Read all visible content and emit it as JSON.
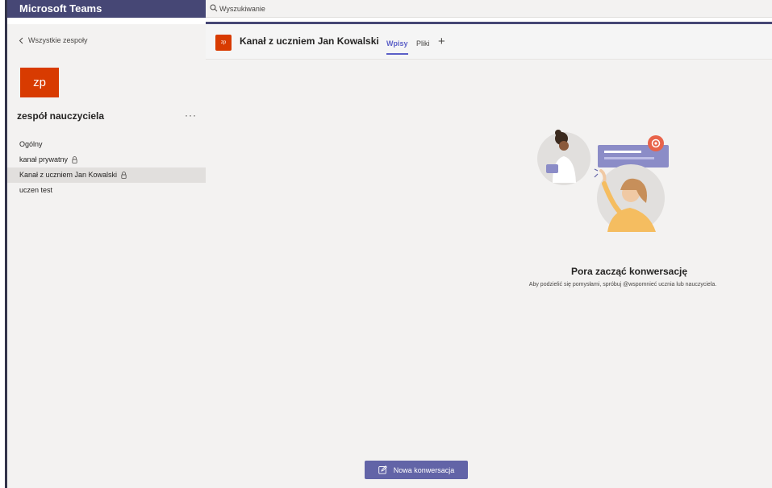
{
  "app": {
    "title": "Microsoft Teams"
  },
  "search": {
    "placeholder": "Wyszukiwanie"
  },
  "sidebar": {
    "back_label": "Wszystkie zespoły",
    "team_initials": "zp",
    "team_name": "zespół nauczyciela",
    "more_label": "···",
    "channels": [
      {
        "label": "Ogólny",
        "private": false,
        "active": false
      },
      {
        "label": "kanał prywatny",
        "private": true,
        "active": false
      },
      {
        "label": "Kanał z uczniem Jan Kowalski",
        "private": true,
        "active": true
      },
      {
        "label": "uczen test",
        "private": false,
        "active": false
      }
    ]
  },
  "channel_header": {
    "avatar_initials": "zp",
    "title": "Kanał z uczniem Jan Kowalski",
    "tabs": [
      {
        "label": "Wpisy",
        "active": true
      },
      {
        "label": "Pliki",
        "active": false
      }
    ],
    "add_tab_label": "+"
  },
  "empty_state": {
    "title": "Pora zacząć konwersację",
    "subtitle": "Aby podzielić się pomysłami, spróbuj @wspomnieć ucznia lub nauczyciela."
  },
  "compose": {
    "new_conversation_label": "Nowa konwersacja"
  },
  "icons": {
    "search": "search-icon",
    "back": "chevron-left-icon",
    "lock": "lock-icon",
    "compose": "compose-icon",
    "mention": "at-mention-icon"
  },
  "colors": {
    "brand_bar": "#464775",
    "accent": "#5b5fc7",
    "button": "#6264a7",
    "team_avatar": "#d83b01",
    "sidebar_bg": "#f3f2f1",
    "selected_channel_bg": "#e1dfdd"
  }
}
